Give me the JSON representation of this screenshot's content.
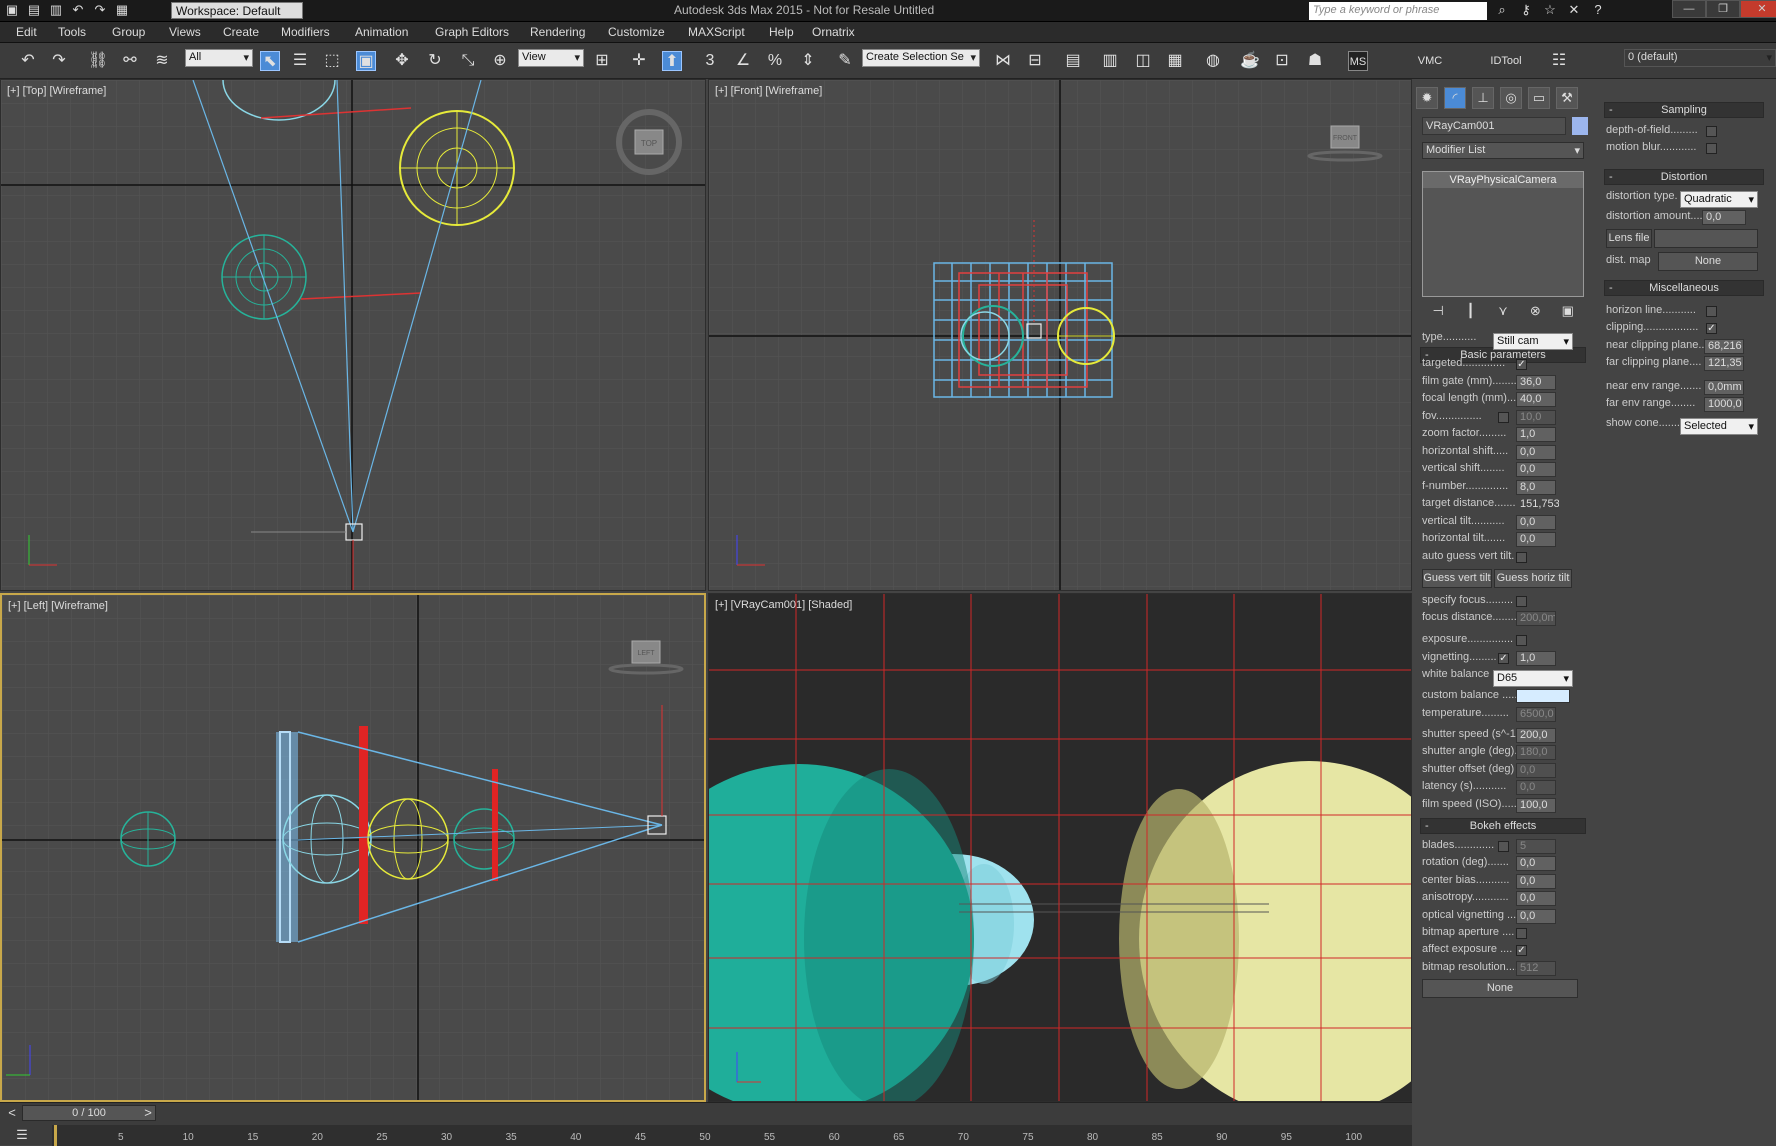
{
  "title_bar": {
    "title": "Autodesk 3ds Max  2015   - Not for Resale   Untitled",
    "workspace": "Workspace: Default",
    "search_placeholder": "Type a keyword or phrase"
  },
  "menu": [
    "Edit",
    "Tools",
    "Group",
    "Views",
    "Create",
    "Modifiers",
    "Animation",
    "Graph Editors",
    "Rendering",
    "Customize",
    "MAXScript",
    "Help",
    "Ornatrix"
  ],
  "toolbar": {
    "filter_value": "All",
    "ref_coord": "View",
    "selection_set": "Create Selection Se",
    "vmc_label": "VMC",
    "idtool_label": "IDTool",
    "layer_value": "0 (default)",
    "snap_labels": [
      "3",
      "%"
    ]
  },
  "viewports": {
    "top_label": "[+] [Top] [Wireframe]",
    "front_label": "[+] [Front] [Wireframe]",
    "left_label": "[+] [Left] [Wireframe]",
    "cam_label": "[+] [VRayCam001] [Shaded]",
    "cube_top": "TOP",
    "cube_front": "FRONT",
    "cube_left": "LEFT"
  },
  "command_panel": {
    "object_name": "VRayCam001",
    "modifier_list": "Modifier List",
    "stack_item": "VRayPhysicalCamera"
  },
  "basic_parameters": {
    "header": "Basic parameters",
    "type_label": "type...........",
    "type_value": "Still cam",
    "targeted": "targeted..............",
    "film_gate": "film gate (mm)........",
    "film_gate_value": "36,0",
    "focal_length": "focal length (mm)...",
    "focal_length_value": "40,0",
    "fov": "fov...............",
    "fov_value": "10,0",
    "zoom_factor": "zoom factor.........",
    "zoom_factor_value": "1,0",
    "horizontal_shift": "horizontal shift.....",
    "horizontal_shift_value": "0,0",
    "vertical_shift": "vertical shift........",
    "vertical_shift_value": "0,0",
    "f_number": "f-number..............",
    "f_number_value": "8,0",
    "target_distance": "target distance.......",
    "target_distance_value": "151,753",
    "vertical_tilt": "vertical tilt...........",
    "vertical_tilt_value": "0,0",
    "horizontal_tilt": "horizontal tilt.......",
    "horizontal_tilt_value": "0,0",
    "auto_guess": "auto guess vert tilt.",
    "guess_vert": "Guess vert tilt",
    "guess_horiz": "Guess horiz tilt",
    "specify_focus": "specify focus.........",
    "focus_distance": "focus distance........",
    "focus_distance_value": "200,0m",
    "exposure": "exposure...............",
    "vignetting": "vignetting.........",
    "vignetting_value": "1,0",
    "white_balance": "white balance",
    "white_balance_value": "D65",
    "custom_balance": "custom balance .....",
    "temperature": "temperature.........",
    "temperature_value": "6500,0",
    "shutter_speed": "shutter speed (s^-1",
    "shutter_speed_value": "200,0",
    "shutter_angle": "shutter angle (deg).",
    "shutter_angle_value": "180,0",
    "shutter_offset": "shutter offset (deg)",
    "shutter_offset_value": "0,0",
    "latency": "latency (s)...........",
    "latency_value": "0,0",
    "film_speed": "film speed (ISO).....",
    "film_speed_value": "100,0"
  },
  "bokeh": {
    "header": "Bokeh effects",
    "blades": "blades.............",
    "blades_value": "5",
    "rotation": "rotation (deg).......",
    "rotation_value": "0,0",
    "center_bias": "center bias...........",
    "center_bias_value": "0,0",
    "anisotropy": "anisotropy............",
    "anisotropy_value": "0,0",
    "optical_vignetting": "optical vignetting ...",
    "optical_vignetting_value": "0,0",
    "bitmap_aperture": "bitmap aperture ....",
    "affect_exposure": "affect exposure ....",
    "bitmap_resolution": "bitmap resolution....",
    "bitmap_resolution_value": "512",
    "none_button": "None"
  },
  "sampling": {
    "header": "Sampling",
    "dof": "depth-of-field.........",
    "motion_blur": "motion blur............"
  },
  "distortion": {
    "header": "Distortion",
    "type_label": "distortion type.",
    "type_value": "Quadratic",
    "amount_label": "distortion amount....",
    "amount_value": "0,0",
    "lens_file": "Lens file",
    "dist_map": "dist. map",
    "dist_map_value": "None"
  },
  "misc": {
    "header": "Miscellaneous",
    "horizon_line": "horizon line...........",
    "clipping": "clipping..................",
    "near_clip": "near clipping plane...",
    "near_clip_value": "68,216",
    "far_clip": "far clipping plane....",
    "far_clip_value": "121,35",
    "near_env": "near env range.......",
    "near_env_value": "0,0mm",
    "far_env": "far env range........",
    "far_env_value": "1000,0",
    "show_cone": "show cone.......",
    "show_cone_value": "Selected"
  },
  "timeline": {
    "slider": "0 / 100",
    "ticks": [
      "5",
      "10",
      "15",
      "20",
      "25",
      "30",
      "35",
      "40",
      "45",
      "50",
      "55",
      "60",
      "65",
      "70",
      "75",
      "80",
      "85",
      "90",
      "95",
      "100"
    ]
  }
}
